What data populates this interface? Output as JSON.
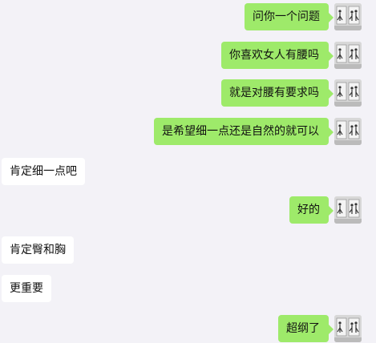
{
  "messages": [
    {
      "side": "out",
      "text": "问你一个问题"
    },
    {
      "side": "out",
      "text": "你喜欢女人有腰吗"
    },
    {
      "side": "out",
      "text": "就是对腰有要求吗"
    },
    {
      "side": "out",
      "text": "是希望细一点还是自然的就可以"
    },
    {
      "side": "in",
      "text": "肯定细一点吧"
    },
    {
      "side": "out",
      "text": "好的"
    },
    {
      "side": "in",
      "text": "肯定臀和胸"
    },
    {
      "side": "in",
      "text": "更重要"
    },
    {
      "side": "out",
      "text": "超纲了"
    }
  ],
  "colors": {
    "outgoing_bubble": "#9eea6a",
    "incoming_bubble": "#ffffff",
    "background": "#f3f2f7"
  },
  "avatar_icon": "figures-photo-icon"
}
